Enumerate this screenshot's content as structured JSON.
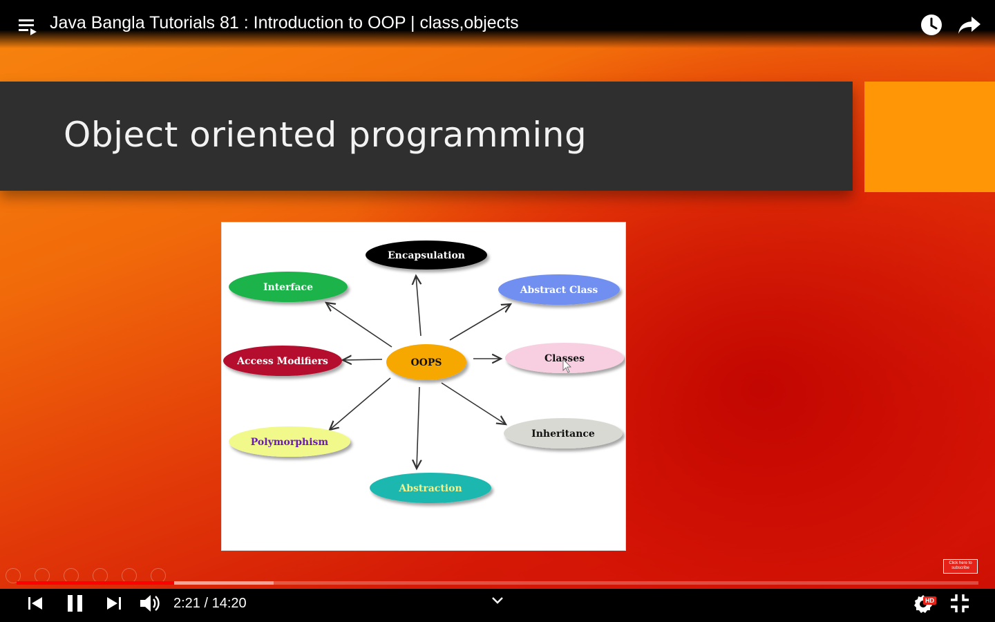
{
  "video": {
    "title": "Java Bangla Tutorials 81 : Introduction to OOP | class,objects",
    "current_time": "2:21",
    "separator": "/",
    "duration": "14:20",
    "played_fraction": 0.164,
    "buffered_fraction": 0.267,
    "quality_badge": "HD"
  },
  "slide": {
    "title": "Object oriented programming",
    "diagram": {
      "center": "OOPS",
      "nodes": [
        {
          "label": "Encapsulation",
          "fill": "#000000",
          "text_color": "#ffffff"
        },
        {
          "label": "Interface",
          "fill": "#1ab34b",
          "text_color": "#ffffff"
        },
        {
          "label": "Abstract Class",
          "fill": "#6f8ff0",
          "text_color": "#ffffff"
        },
        {
          "label": "Access Modifiers",
          "fill": "#b4102e",
          "text_color": "#ffffff"
        },
        {
          "label": "Classes",
          "fill": "#f7cfe0",
          "text_color": "#111111"
        },
        {
          "label": "Polymorphism",
          "fill": "#f1f98a",
          "text_color": "#6a1ab8"
        },
        {
          "label": "Inheritance",
          "fill": "#d9d9d4",
          "text_color": "#111111"
        },
        {
          "label": "Abstraction",
          "fill": "#1ab8b0",
          "text_color": "#f4f28a"
        }
      ],
      "center_fill": "#f7a800"
    }
  },
  "watermark": {
    "line1": "Click here to",
    "line2": "subscribe"
  },
  "colors": {
    "progress_played": "#ff0000",
    "title_band": "#2f2f2f",
    "orange_block": "#ff9606"
  },
  "icons": {
    "menu": "playlist-icon",
    "watch_later": "clock-icon",
    "share": "share-icon",
    "previous": "skip-previous-icon",
    "pause": "pause-icon",
    "next": "skip-next-icon",
    "volume": "volume-icon",
    "chevron": "chevron-down-icon",
    "settings": "gear-icon",
    "exit_fullscreen": "exit-fullscreen-icon"
  }
}
